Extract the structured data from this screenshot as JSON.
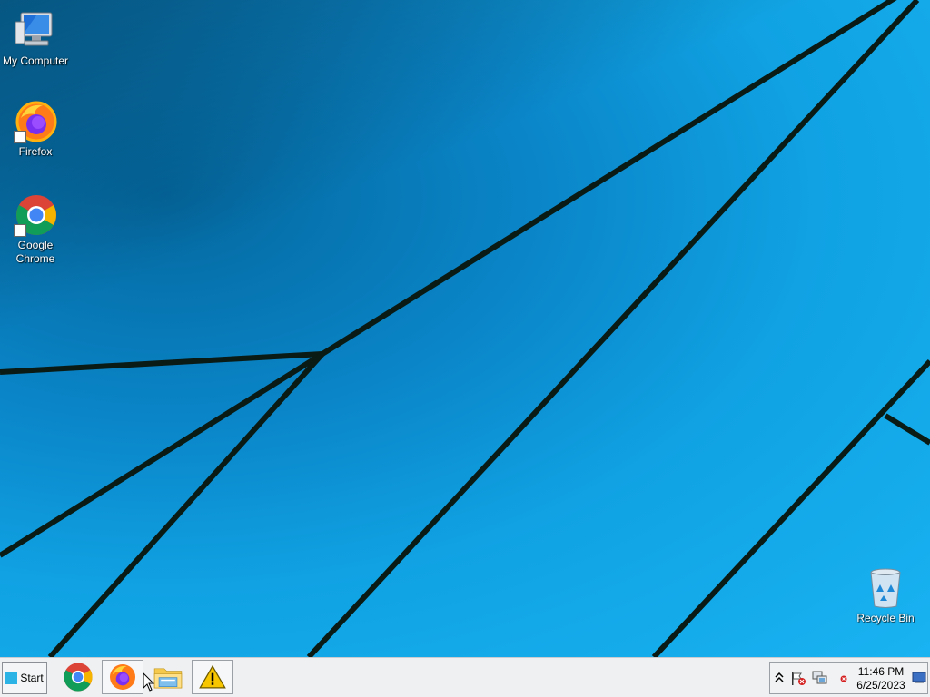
{
  "desktop": {
    "icons": [
      {
        "label": "My Computer",
        "icon": "computer-icon"
      },
      {
        "label": "Firefox",
        "icon": "firefox-icon"
      },
      {
        "label": "Google\nChrome",
        "icon": "chrome-icon"
      },
      {
        "label": "Recycle Bin",
        "icon": "recycle-bin-icon"
      }
    ]
  },
  "taskbar": {
    "start_label": "Start",
    "pinned": [
      {
        "icon": "chrome-icon"
      },
      {
        "icon": "firefox-icon"
      },
      {
        "icon": "file-explorer-icon"
      },
      {
        "icon": "warning-icon"
      }
    ],
    "tray": {
      "icons": [
        "show-hidden-icons-chevron-icon",
        "action-center-flag-icon",
        "network-icon",
        "error-icon",
        "show-desktop-icon"
      ],
      "time": "11:46 PM",
      "date": "6/25/2023"
    }
  },
  "colors": {
    "wallpaper_light": "#19b3f2",
    "wallpaper_dark": "#04689f",
    "taskbar_bg": "#eef0f2"
  }
}
